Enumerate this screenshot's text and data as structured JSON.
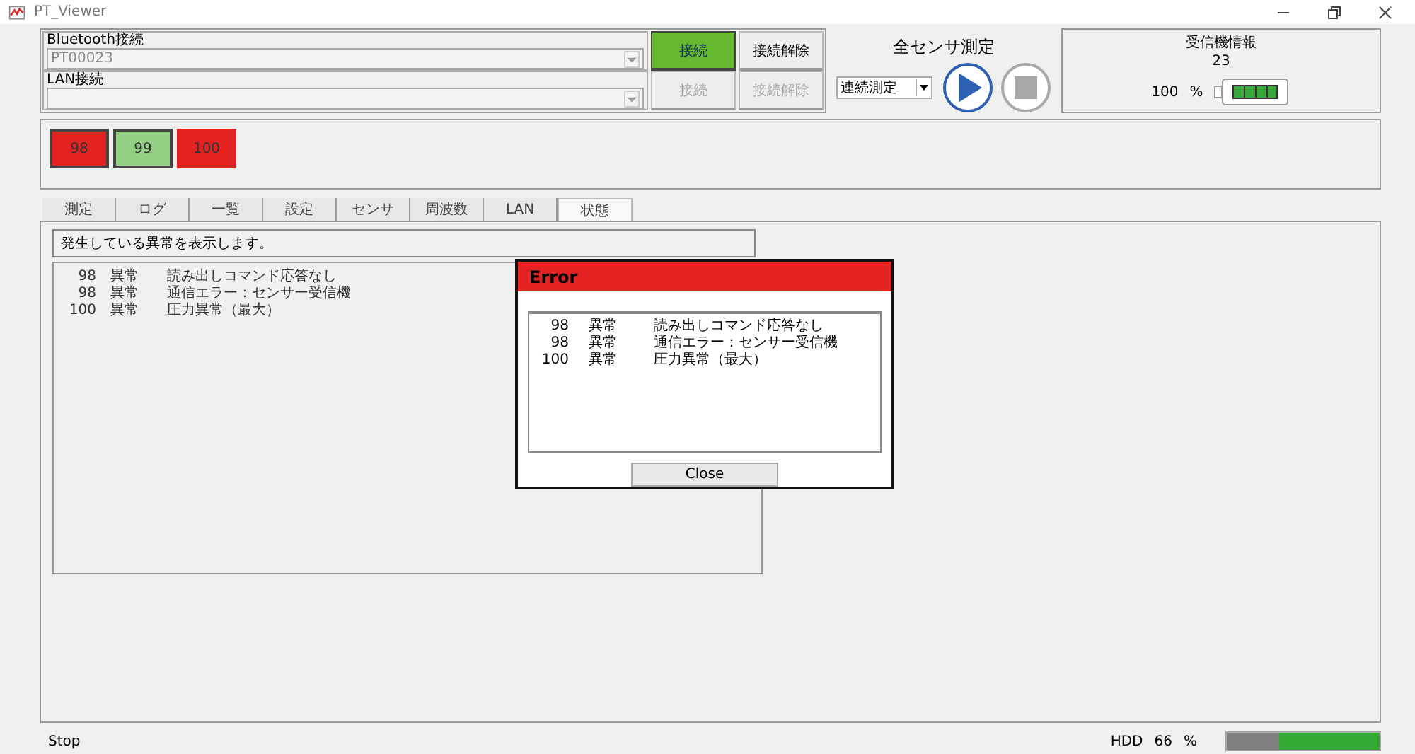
{
  "window": {
    "title": "PT_Viewer"
  },
  "connections": [
    {
      "label": "Bluetooth接続",
      "value": "PT00023",
      "connect": "接続",
      "disconnect": "接続解除",
      "connected": true,
      "disabled": false
    },
    {
      "label": "LAN接続",
      "connect": "接続",
      "disconnect": "接続解除",
      "connected": false,
      "disabled": true
    }
  ],
  "measure": {
    "title": "全センサ測定",
    "mode": "連続測定"
  },
  "receiver": {
    "title": "受信機情報",
    "id": "23",
    "battery": "100",
    "unit": "%"
  },
  "sensors": [
    {
      "label": "98",
      "color": "#e52222",
      "selected": true
    },
    {
      "label": "99",
      "color": "#94d084",
      "selected": true
    },
    {
      "label": "100",
      "color": "#e52222",
      "selected": false
    }
  ],
  "tabs": [
    {
      "label": "測定",
      "selected": false
    },
    {
      "label": "ログ",
      "selected": false
    },
    {
      "label": "一覧",
      "selected": false
    },
    {
      "label": "設定",
      "selected": false
    },
    {
      "label": "センサ",
      "selected": false
    },
    {
      "label": "周波数",
      "selected": false
    },
    {
      "label": "LAN",
      "selected": false
    },
    {
      "label": "状態",
      "selected": true
    }
  ],
  "status_panel": {
    "heading": "発生している異常を表示します。",
    "rows": [
      {
        "id": "98",
        "status": "異常",
        "message": "読み出しコマンド応答なし"
      },
      {
        "id": "98",
        "status": "異常",
        "message": "通信エラー：センサー受信機"
      },
      {
        "id": "100",
        "status": "異常",
        "message": "圧力異常（最大）"
      }
    ]
  },
  "dialog": {
    "title": "Error",
    "rows": [
      {
        "id": "98",
        "status": "異常",
        "message": "読み出しコマンド応答なし"
      },
      {
        "id": "98",
        "status": "異常",
        "message": "通信エラー：センサー受信機"
      },
      {
        "id": "100",
        "status": "異常",
        "message": "圧力異常（最大）"
      }
    ],
    "button": "Close"
  },
  "status_bar": {
    "state": "Stop",
    "hdd_label": "HDD",
    "hdd_value": "66",
    "hdd_unit": "%",
    "level": 0.66
  }
}
